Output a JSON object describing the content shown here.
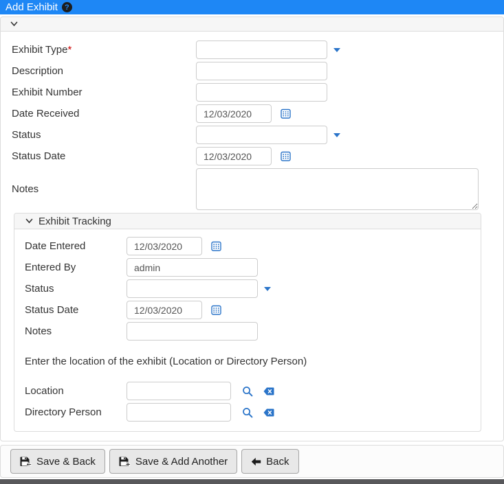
{
  "header": {
    "title": "Add Exhibit"
  },
  "main_form": {
    "exhibit_type": {
      "label": "Exhibit Type",
      "required": "*",
      "value": ""
    },
    "description": {
      "label": "Description",
      "value": ""
    },
    "exhibit_number": {
      "label": "Exhibit Number",
      "value": ""
    },
    "date_received": {
      "label": "Date Received",
      "value": "12/03/2020"
    },
    "status": {
      "label": "Status",
      "value": ""
    },
    "status_date": {
      "label": "Status Date",
      "value": "12/03/2020"
    },
    "notes": {
      "label": "Notes",
      "value": ""
    }
  },
  "tracking": {
    "title": "Exhibit Tracking",
    "date_entered": {
      "label": "Date Entered",
      "value": "12/03/2020"
    },
    "entered_by": {
      "label": "Entered By",
      "value": "admin"
    },
    "status": {
      "label": "Status",
      "value": ""
    },
    "status_date": {
      "label": "Status Date",
      "value": "12/03/2020"
    },
    "notes": {
      "label": "Notes",
      "value": ""
    },
    "location_instruction": "Enter the location of the exhibit (Location or Directory Person)",
    "location": {
      "label": "Location",
      "value": ""
    },
    "directory_person": {
      "label": "Directory Person",
      "value": ""
    }
  },
  "footer": {
    "save_back_label": "Save & Back",
    "save_add_label": "Save & Add Another",
    "back_label": "Back"
  },
  "icons": {
    "help": "question-circle-icon",
    "collapse": "chevron-down-icon",
    "dropdown": "caret-down-icon",
    "date_picker": "calendar-icon",
    "lookup": "search-icon",
    "clear": "backspace-clear-icon",
    "save": "floppy-save-icon",
    "back": "arrow-left-icon"
  },
  "colors": {
    "header_bg": "#1e87f5",
    "icon_blue": "#2a74c9",
    "required_red": "#cc0000",
    "panel_header_bg": "#f6f6f6",
    "bottom_strip": "#58585b"
  }
}
